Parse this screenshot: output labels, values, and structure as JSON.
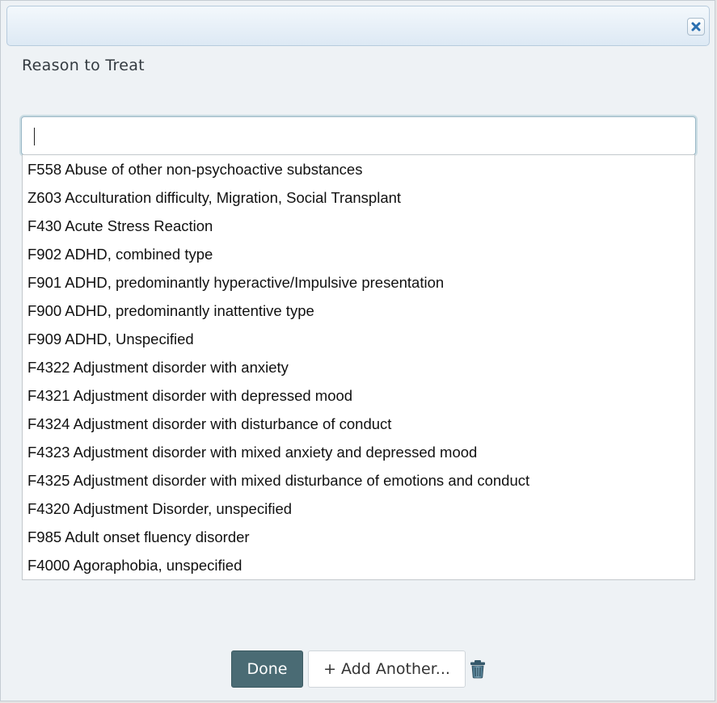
{
  "dialog": {
    "close_icon": "close-icon",
    "label": "Reason to Treat"
  },
  "search": {
    "value": "",
    "placeholder": ""
  },
  "options": [
    "F558 Abuse of other non-psychoactive substances",
    "Z603 Acculturation difficulty, Migration, Social Transplant",
    "F430 Acute Stress Reaction",
    "F902 ADHD, combined type",
    "F901 ADHD, predominantly hyperactive/Impulsive presentation",
    "F900 ADHD, predominantly inattentive type",
    "F909 ADHD, Unspecified",
    "F4322 Adjustment disorder with anxiety",
    "F4321 Adjustment disorder with depressed mood",
    "F4324 Adjustment disorder with disturbance of conduct",
    "F4323 Adjustment disorder with mixed anxiety and depressed mood",
    "F4325 Adjustment disorder with mixed disturbance of emotions and conduct",
    "F4320 Adjustment Disorder, unspecified",
    "F985 Adult onset fluency disorder",
    "F4000 Agoraphobia, unspecified"
  ],
  "footer": {
    "done_label": "Done",
    "add_label": "+ Add Another...",
    "trash_icon": "trash-icon"
  },
  "colors": {
    "done_bg": "#4a6b74",
    "dialog_bg": "#eef2f5",
    "titlebar_bg": "#dde9f4",
    "close_icon": "#2a6fb0"
  }
}
